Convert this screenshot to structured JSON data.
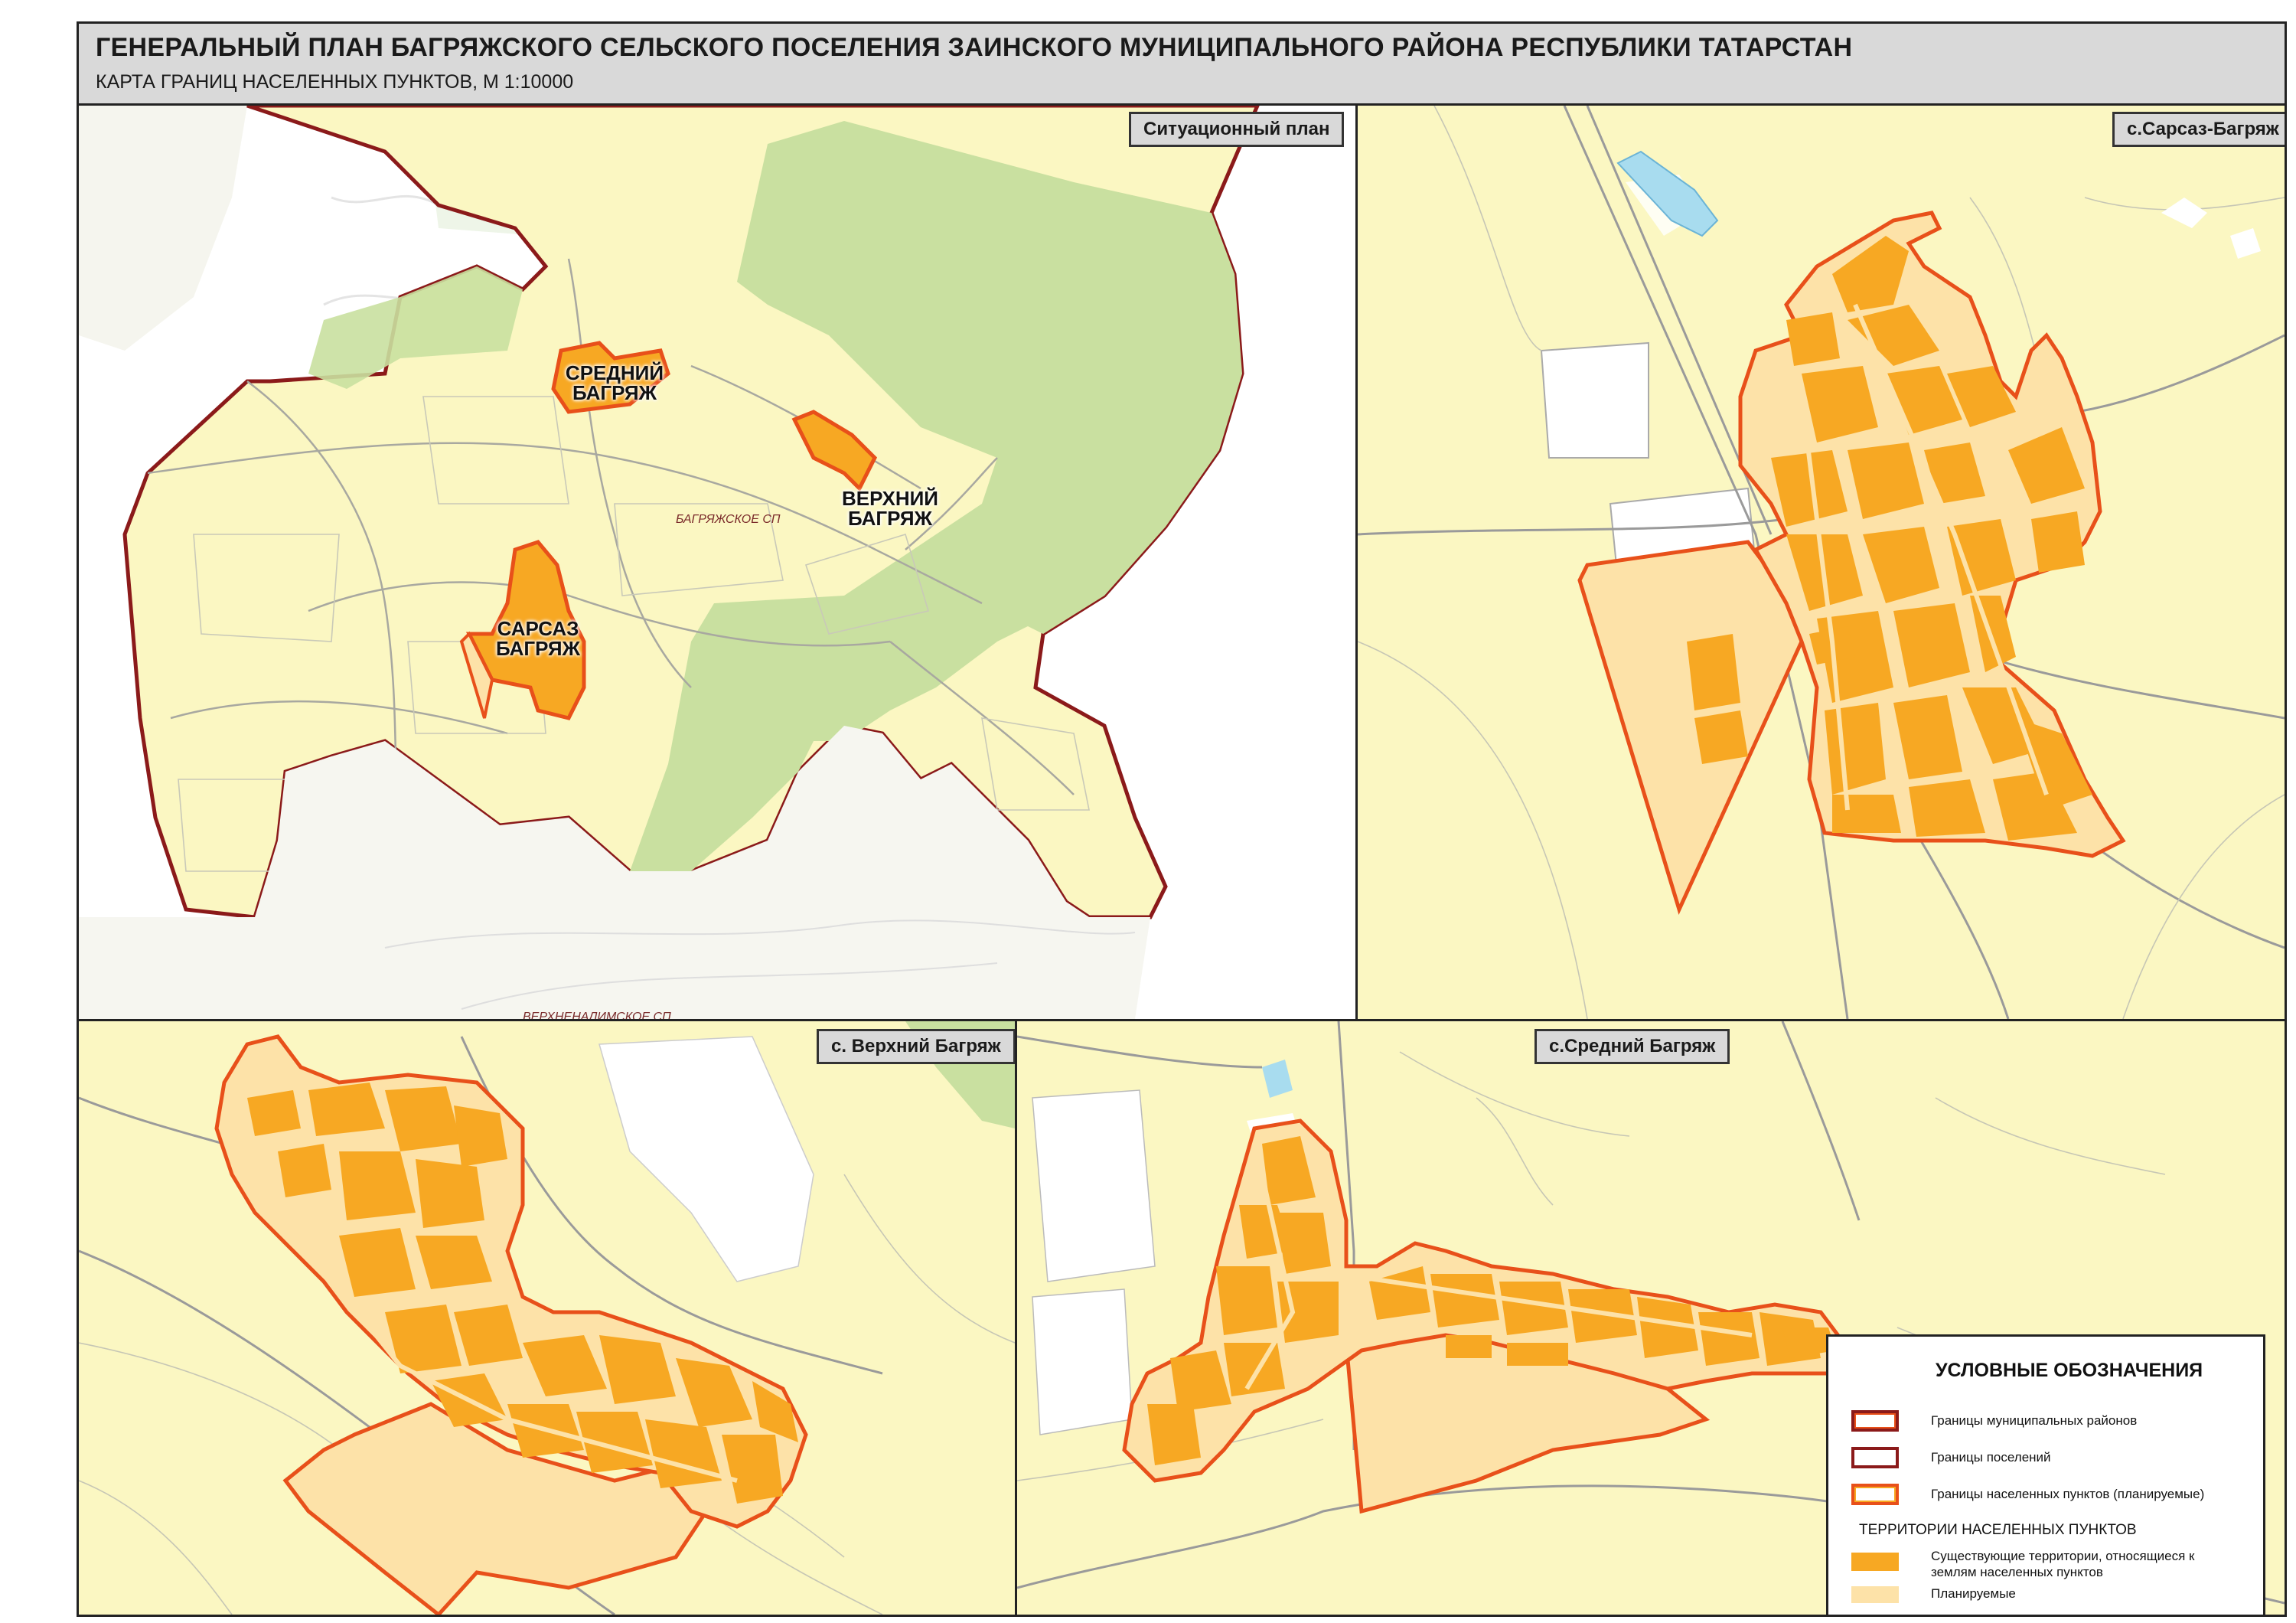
{
  "header": {
    "title": "ГЕНЕРАЛЬНЫЙ ПЛАН БАГРЯЖСКОГО СЕЛЬСКОГО ПОСЕЛЕНИЯ ЗАИНСКОГО МУНИЦИПАЛЬНОГО РАЙОНА РЕСПУБЛИКИ ТАТАРСТАН",
    "subtitle": "КАРТА ГРАНИЦ НАСЕЛЕННЫХ ПУНКТОВ, М 1:10000"
  },
  "panels": {
    "situation": {
      "label": "Ситуационный план",
      "settlements": [
        {
          "line1": "СРЕДНИЙ",
          "line2": "БАГРЯЖ"
        },
        {
          "line1": "ВЕРХНИЙ",
          "line2": "БАГРЯЖ"
        },
        {
          "line1": "САРСАЗ",
          "line2": "БАГРЯЖ"
        }
      ],
      "sp_labels": {
        "bagryazh": "БАГРЯЖСКОЕ СП",
        "south": "ВЕРХНЕНАЛИМСКОЕ СП"
      }
    },
    "sarsaz": {
      "label": "с.Сарсаз-Багряж"
    },
    "verkhny": {
      "label": "с. Верхний Багряж"
    },
    "sredny": {
      "label": "с.Средний Багряж"
    }
  },
  "legend": {
    "title": "УСЛОВНЫЕ ОБОЗНАЧЕНИЯ",
    "items": [
      {
        "label": "Границы муниципальных районов",
        "symbol": "municipal-boundary"
      },
      {
        "label": "Границы поселений",
        "symbol": "settlement-boundary"
      },
      {
        "label": "Границы населенных пунктов (планируемые)",
        "symbol": "locality-boundary-planned"
      }
    ],
    "subheading": "ТЕРРИТОРИИ НАСЕЛЕННЫХ ПУНКТОВ",
    "territories": [
      {
        "label": "Существующие территории, относящиеся к землям населенных пунктов",
        "symbol": "existing-territory"
      },
      {
        "label": "Планируемые",
        "symbol": "planned-territory"
      }
    ]
  },
  "colors": {
    "background_field": "#fbf7c2",
    "forest": "#c9e0a0",
    "existing_territory": "#f7a823",
    "planned_territory": "#fde2a8",
    "municipal_boundary": "#8b1a1a",
    "locality_boundary": "#e8501a",
    "water": "#a8dcef",
    "roads": "#9a9a9a",
    "header_bg": "#d9d9d9"
  }
}
